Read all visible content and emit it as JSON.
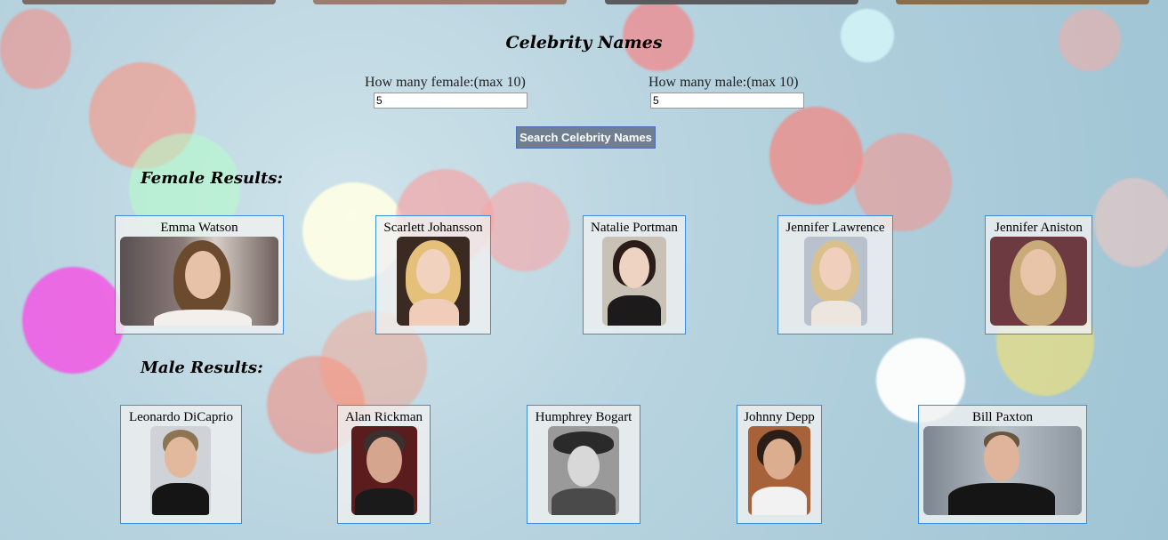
{
  "title": "Celebrity Names",
  "query": {
    "female_label": "How many female:(max 10)",
    "female_value": "5",
    "male_label": "How many male:(max 10)",
    "male_value": "5"
  },
  "search_button": "Search Celebrity Names",
  "female_heading": "Female Results:",
  "male_heading": "Male Results:",
  "female_results": [
    {
      "name": "Emma Watson"
    },
    {
      "name": "Scarlett Johansson"
    },
    {
      "name": "Natalie Portman"
    },
    {
      "name": "Jennifer Lawrence"
    },
    {
      "name": "Jennifer Aniston"
    }
  ],
  "male_results": [
    {
      "name": "Leonardo DiCaprio"
    },
    {
      "name": "Alan Rickman"
    },
    {
      "name": "Humphrey Bogart"
    },
    {
      "name": "Johnny Depp"
    },
    {
      "name": "Bill Paxton"
    }
  ],
  "colors": {
    "card_border": "#3a8fd8",
    "button_bg": "#6f7f91"
  }
}
